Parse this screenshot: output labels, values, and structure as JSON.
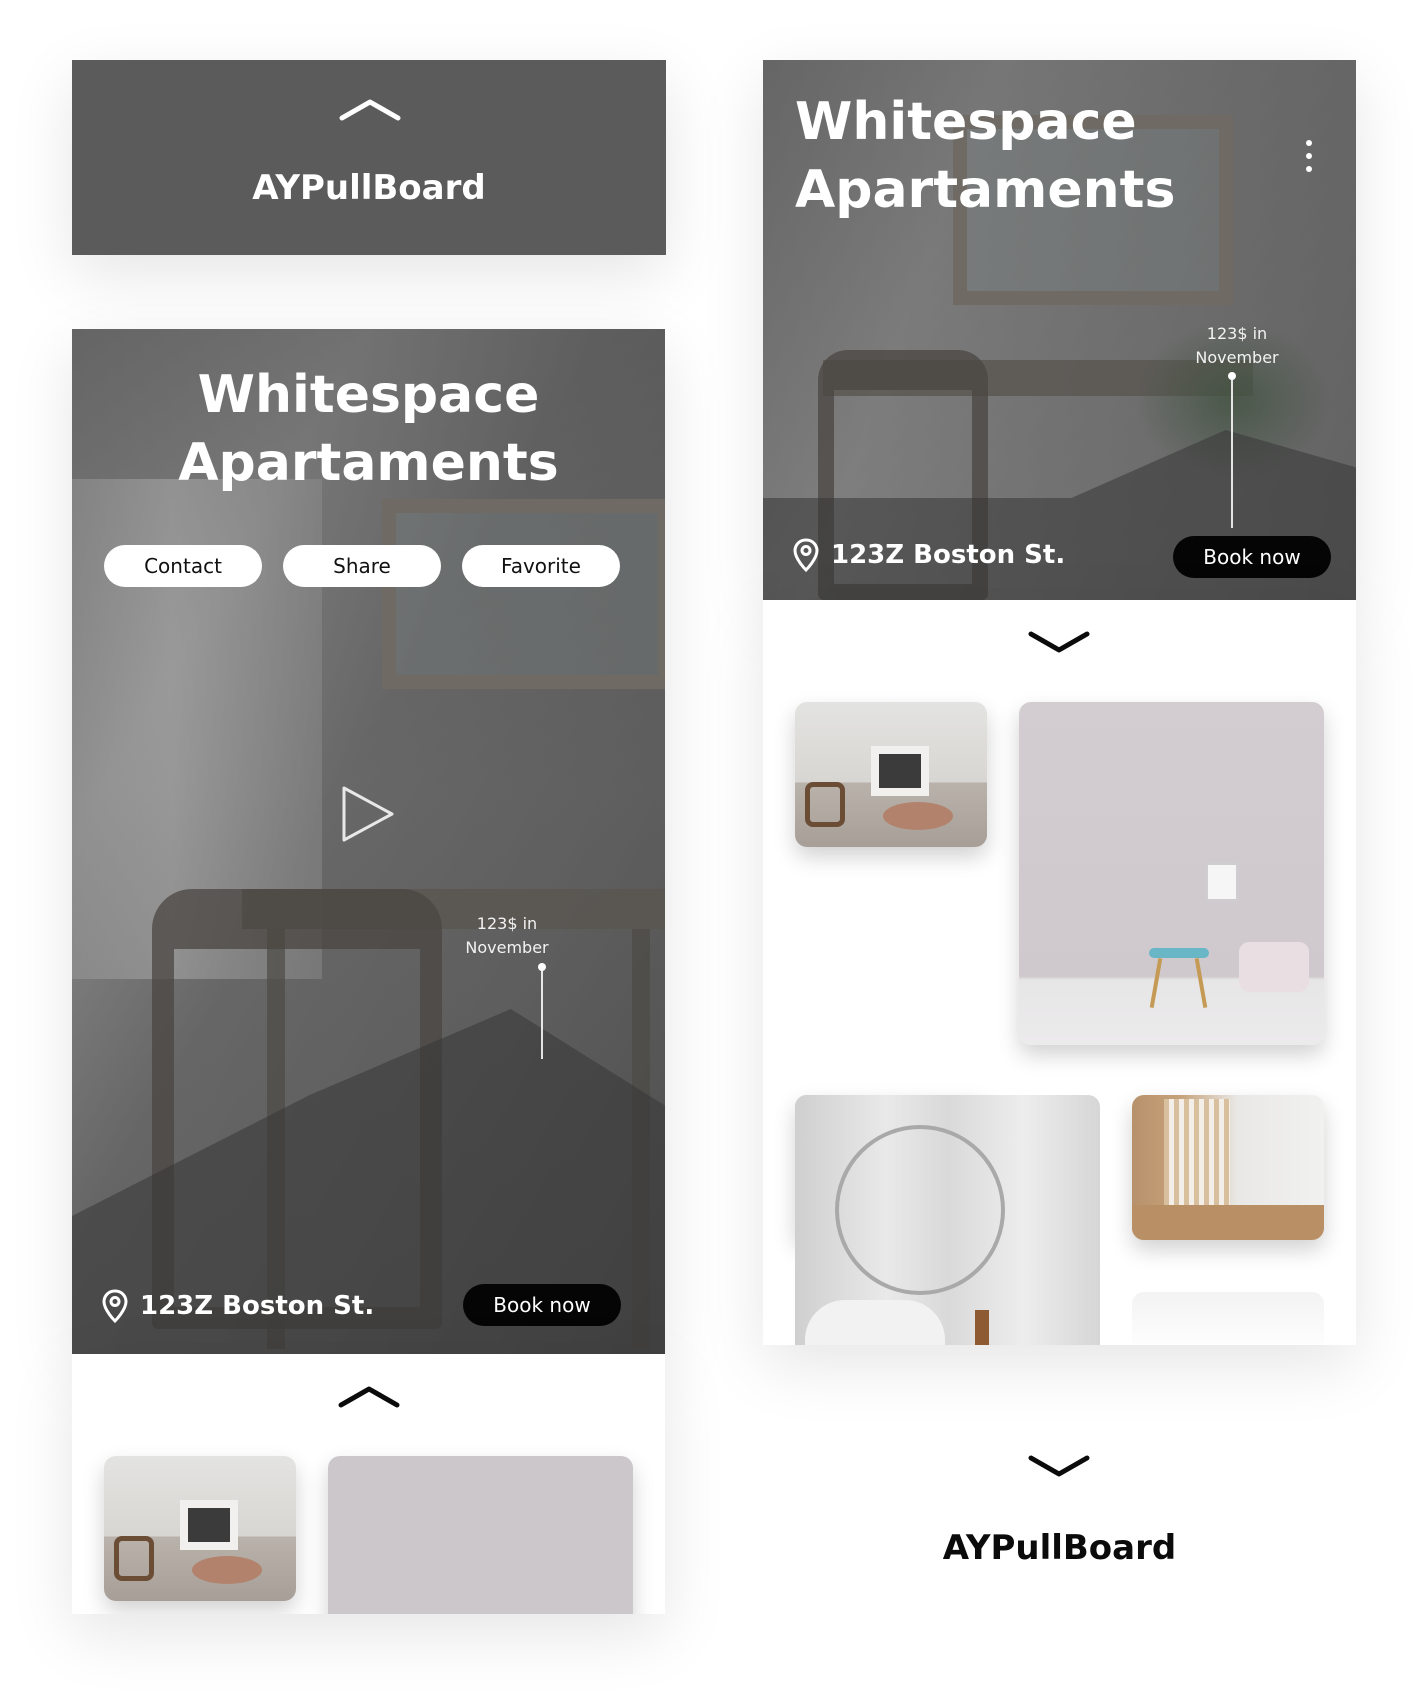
{
  "brand": {
    "name": "AYPullBoard"
  },
  "listing": {
    "title_line1": "Whitespace",
    "title_line2": "Apartaments",
    "address": "123Z Boston St.",
    "price_line1": "123$ in",
    "price_line2": "November",
    "book_label": "Book now"
  },
  "actions": {
    "contact": "Contact",
    "share": "Share",
    "favorite": "Favorite"
  },
  "icons": {
    "expand": "chevron-up-icon",
    "collapse": "chevron-down-icon",
    "location": "map-pin-icon",
    "play": "play-icon",
    "menu": "kebab-menu-icon"
  },
  "colors": {
    "banner_bg": "#5b5b5b",
    "button_dark": "#050505",
    "button_light": "#ffffff"
  }
}
